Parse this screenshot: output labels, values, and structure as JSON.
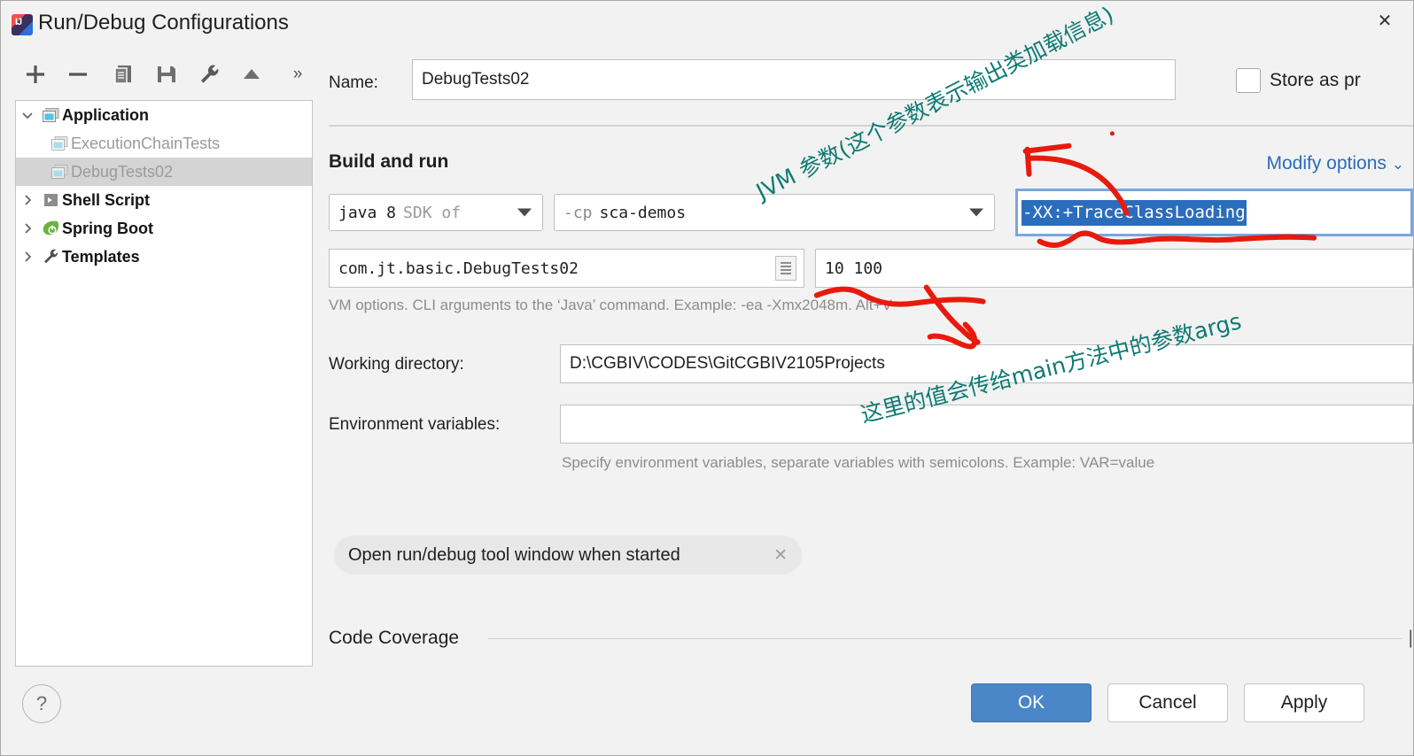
{
  "window": {
    "title": "Run/Debug Configurations",
    "app_icon": "intellij-idea-icon",
    "close_label": "✕"
  },
  "toolbar": {
    "buttons": [
      {
        "name": "add-button",
        "icon": "plus-icon"
      },
      {
        "name": "remove-button",
        "icon": "minus-icon"
      },
      {
        "name": "copy-button",
        "icon": "copy-icon"
      },
      {
        "name": "save-button",
        "icon": "floppy-disk-icon"
      },
      {
        "name": "edit-templates-button",
        "icon": "wrench-icon"
      },
      {
        "name": "move-up-button",
        "icon": "triangle-up-icon"
      },
      {
        "name": "more-button",
        "icon": "chevron-double-right-icon",
        "label": "»"
      }
    ]
  },
  "tree": {
    "items": [
      {
        "label": "Application",
        "level": 0,
        "expanded": true,
        "bold": true,
        "selected": false,
        "icon": "application-icon"
      },
      {
        "label": "ExecutionChainTests",
        "level": 1,
        "expanded": null,
        "bold": false,
        "selected": false,
        "icon": "application-icon"
      },
      {
        "label": "DebugTests02",
        "level": 1,
        "expanded": null,
        "bold": false,
        "selected": true,
        "icon": "application-icon"
      },
      {
        "label": "Shell Script",
        "level": 0,
        "expanded": false,
        "bold": true,
        "selected": false,
        "icon": "shell-script-icon"
      },
      {
        "label": "Spring Boot",
        "level": 0,
        "expanded": false,
        "bold": true,
        "selected": false,
        "icon": "spring-boot-icon"
      },
      {
        "label": "Templates",
        "level": 0,
        "expanded": false,
        "bold": true,
        "selected": false,
        "icon": "wrench-icon"
      }
    ]
  },
  "form": {
    "name_label": "Name:",
    "name_value": "DebugTests02",
    "store_as_project_file_label": "Store as pr",
    "store_as_project_file_checked": false,
    "section_title": "Build and run",
    "modify_options_label": "Modify options",
    "sdk_value": "java 8",
    "sdk_value_secondary": "SDK of",
    "classpath_value_flag": "-cp",
    "classpath_value": "sca-demos",
    "main_class_value": "com.jt.basic.DebugTests02",
    "program_arguments_value": "10 100",
    "vm_options_value": "-XX:+TraceClassLoading",
    "vm_options_hint": "VM options. CLI arguments to the ‘Java’ command. Example: -ea -Xmx2048m. Alt+V",
    "working_directory_label": "Working directory:",
    "working_directory_value": "D:\\CGBIV\\CODES\\GitCGBIV2105Projects",
    "environment_variables_label": "Environment variables:",
    "environment_variables_value": "",
    "environment_variables_hint": "Specify environment variables, separate variables with semicolons. Example: VAR=value",
    "chip_label": "Open run/debug tool window when started",
    "chip_close": "✕",
    "code_coverage_label": "Code Coverage",
    "code_coverage_edge": "|"
  },
  "footer": {
    "help_label": "?",
    "ok_label": "OK",
    "cancel_label": "Cancel",
    "apply_label": "Apply"
  },
  "annotations": {
    "color_text": "#0e7a73",
    "color_ink": "#e81a0c",
    "note_1": "JVM 参数(这个参数表示输出类加载信息)",
    "note_2": "这里的值会传给main方法中的参数args"
  }
}
